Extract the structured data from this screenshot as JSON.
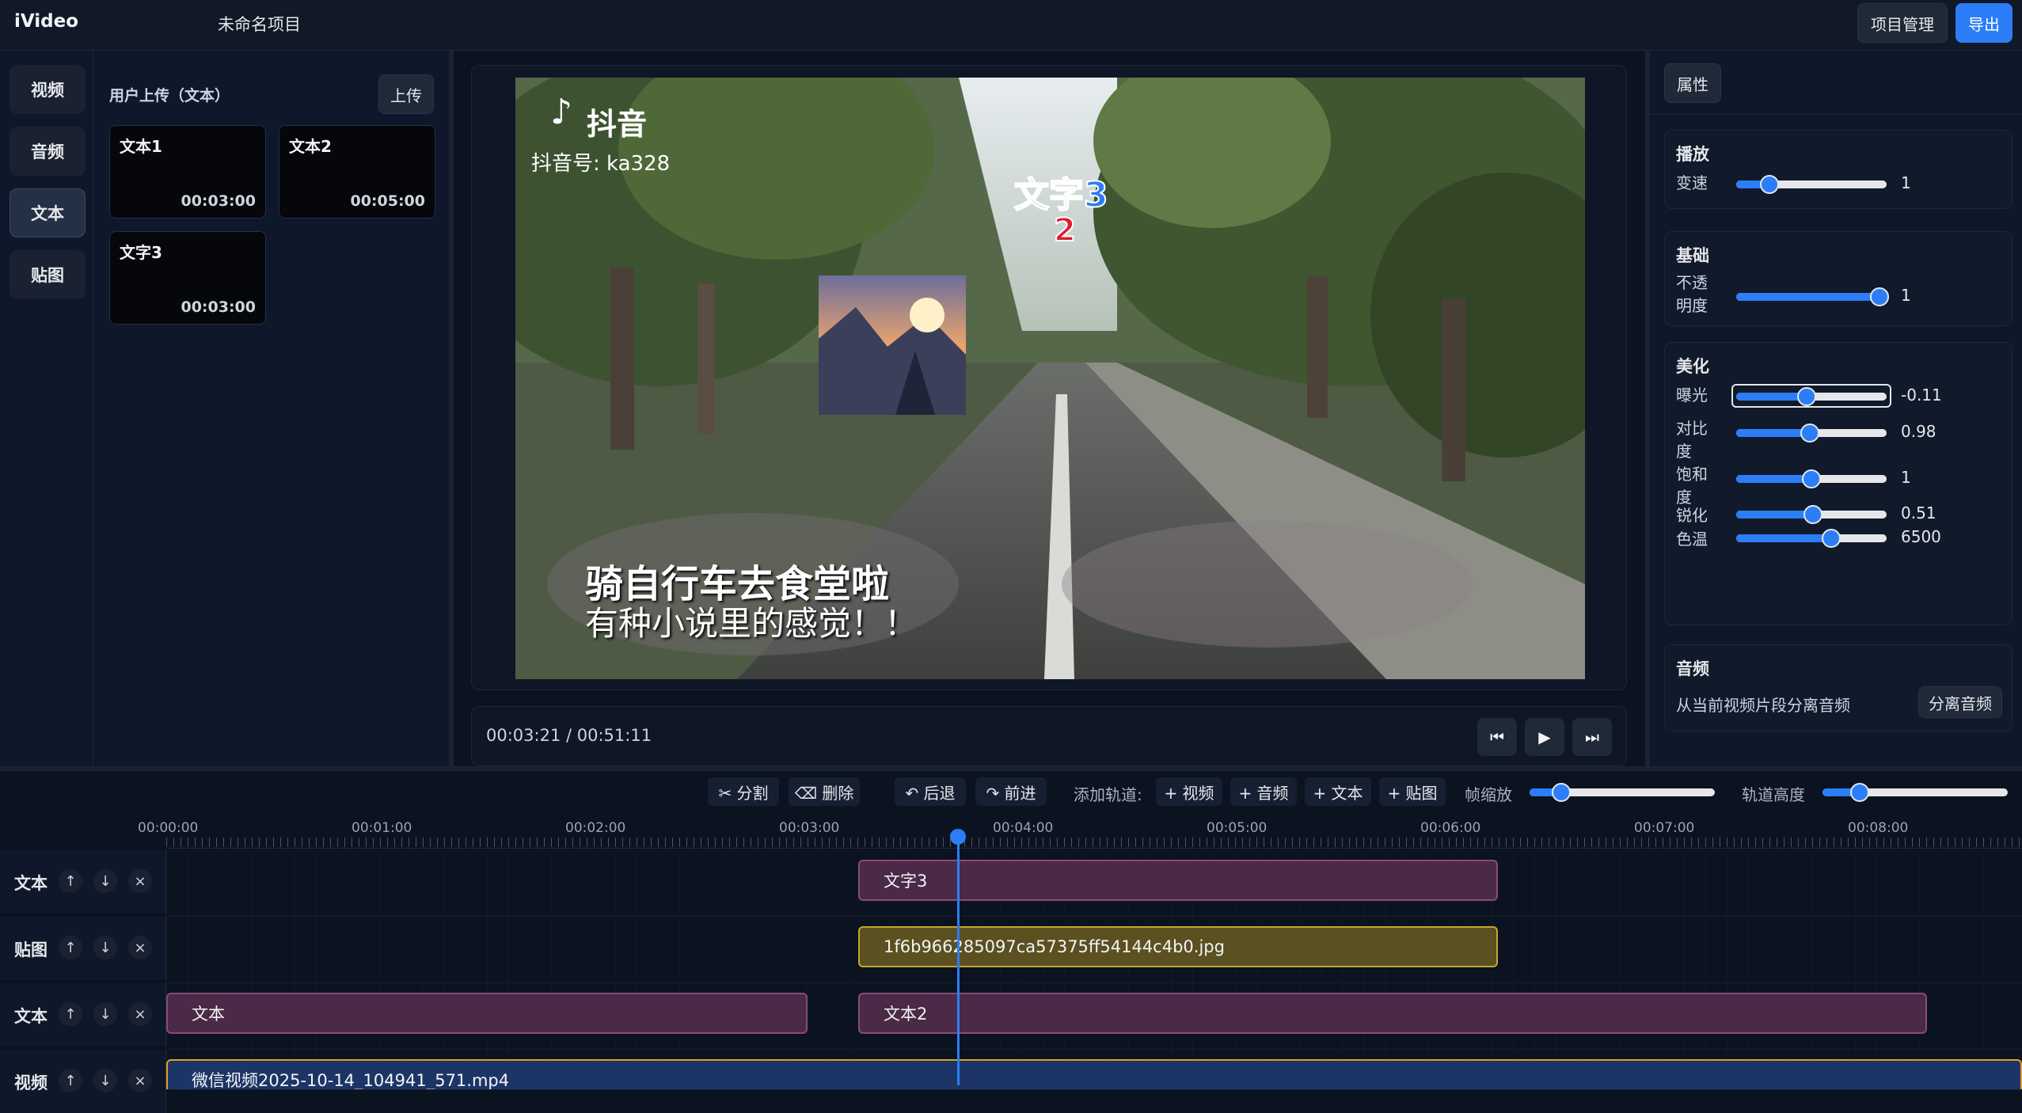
{
  "header": {
    "app_name": "iVideo",
    "project_title": "未命名项目",
    "project_manage": "项目管理",
    "export": "导出"
  },
  "left_nav": {
    "items": [
      {
        "label": "视频",
        "active": false
      },
      {
        "label": "音频",
        "active": false
      },
      {
        "label": "文本",
        "active": true
      },
      {
        "label": "贴图",
        "active": false
      }
    ]
  },
  "assets": {
    "title": "用户上传（文本）",
    "upload": "上传",
    "cards": [
      {
        "name": "文本1",
        "duration": "00:03:00"
      },
      {
        "name": "文本2",
        "duration": "00:05:00"
      },
      {
        "name": "文字3",
        "duration": "00:03:00"
      }
    ]
  },
  "preview": {
    "watermark_brand": "抖音",
    "watermark_id": "抖音号: ka328",
    "caption_line1": "骑自行车去食堂啦",
    "caption_line2": "有种小说里的感觉！！",
    "overlay_text_main": "文字3",
    "overlay_text_partial": "2"
  },
  "controls": {
    "timecode": "00:03:21 / 00:51:11",
    "prev_icon": "⏮",
    "play_icon": "▶",
    "next_icon": "⏭"
  },
  "properties": {
    "tab": "属性",
    "playback": {
      "title": "播放",
      "speed_label": "变速",
      "speed_value": "1",
      "speed_fraction": 0.22
    },
    "basic": {
      "title": "基础",
      "opacity_label": "不透明度",
      "opacity_value": "1",
      "opacity_fraction": 0.95
    },
    "beautify": {
      "title": "美化",
      "rows": [
        {
          "label": "曝光",
          "value": "-0.11",
          "fraction": 0.47
        },
        {
          "label": "对比度",
          "value": "0.98",
          "fraction": 0.49
        },
        {
          "label": "饱和度",
          "value": "1",
          "fraction": 0.5
        },
        {
          "label": "锐化",
          "value": "0.51",
          "fraction": 0.51
        },
        {
          "label": "色温",
          "value": "6500",
          "fraction": 0.63
        }
      ]
    },
    "audio": {
      "title": "音频",
      "desc": "从当前视频片段分离音频",
      "button": "分离音频"
    }
  },
  "timeline": {
    "toolbar": {
      "split": "✂ 分割",
      "delete": "⌫ 删除",
      "undo": "↶ 后退",
      "redo": "↷ 前进",
      "add_track_label": "添加轨道:",
      "add_video": "+ 视频",
      "add_audio": "+ 音频",
      "add_text": "+ 文本",
      "add_sticker": "+ 贴图",
      "zoom_label": "帧缩放",
      "zoom_fraction": 0.17,
      "height_label": "轨道高度",
      "height_fraction": 0.2
    },
    "ruler": [
      "00:00:00",
      "00:01:00",
      "00:02:00",
      "00:03:00",
      "00:04:00",
      "00:05:00",
      "00:06:00",
      "00:07:00",
      "00:08:00"
    ],
    "tracks": [
      {
        "name": "文本",
        "clips": [
          {
            "label": "文字3"
          }
        ]
      },
      {
        "name": "贴图",
        "clips": [
          {
            "label": "1f6b966285097ca57375ff54144c4b0.jpg"
          }
        ]
      },
      {
        "name": "文本",
        "clips": [
          {
            "label": "文本"
          },
          {
            "label": "文本2"
          }
        ]
      },
      {
        "name": "视频",
        "clips": [
          {
            "label": "微信视频2025-10-14_104941_571.mp4"
          }
        ]
      }
    ],
    "track_up": "↑",
    "track_down": "↓",
    "track_remove": "×"
  }
}
